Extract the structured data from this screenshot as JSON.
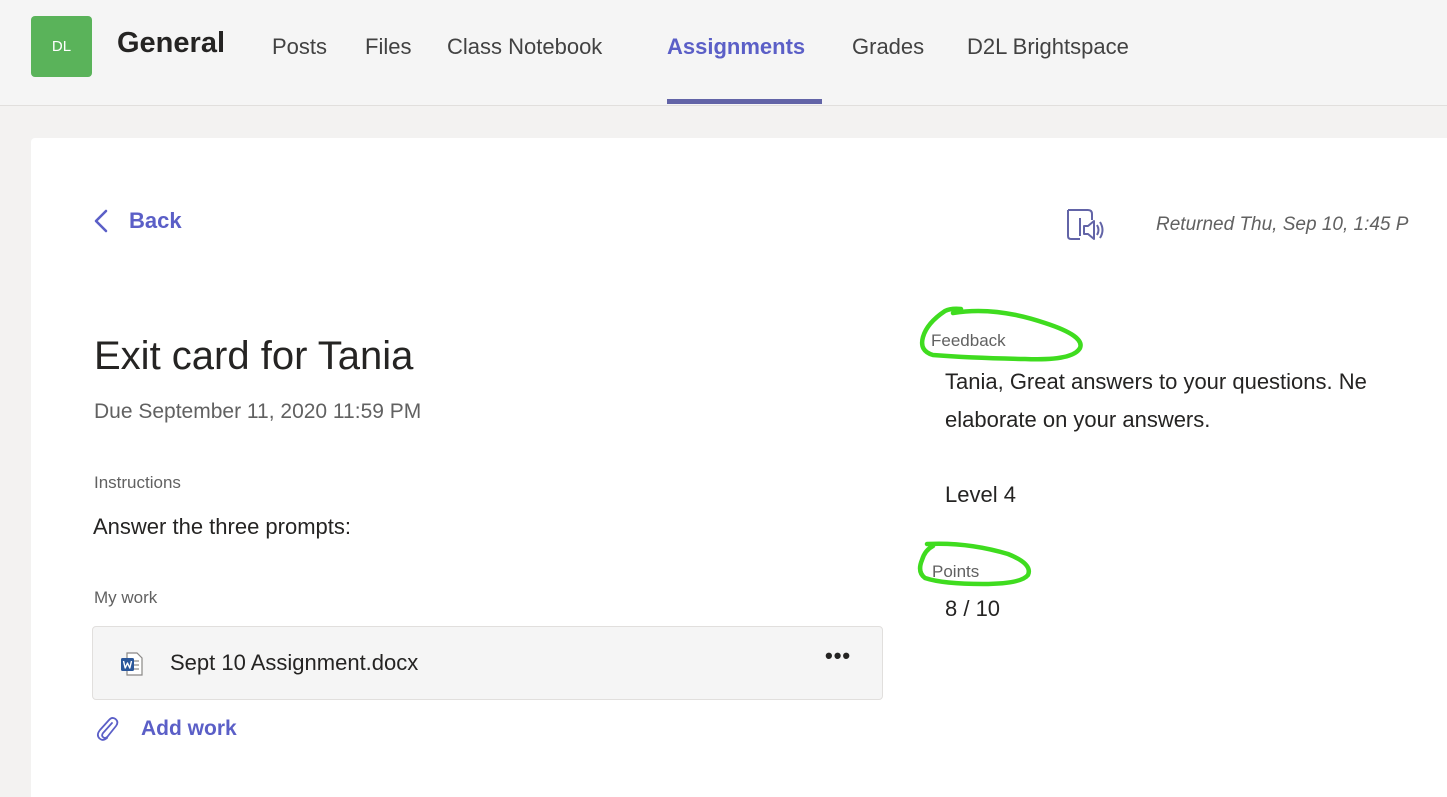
{
  "header": {
    "avatar_initials": "DL",
    "channel": "General",
    "tabs": [
      {
        "label": "Posts"
      },
      {
        "label": "Files"
      },
      {
        "label": "Class Notebook"
      },
      {
        "label": "Assignments",
        "active": true
      },
      {
        "label": "Grades"
      },
      {
        "label": "D2L Brightspace"
      }
    ]
  },
  "nav": {
    "back_label": "Back",
    "returned_text": "Returned Thu, Sep 10, 1:45 P"
  },
  "assignment": {
    "title": "Exit card for Tania",
    "due": "Due September 11, 2020 11:59 PM",
    "instructions_label": "Instructions",
    "instructions": "Answer the three prompts:",
    "my_work_label": "My work",
    "file_name": "Sept 10 Assignment.docx",
    "more_label": "•••",
    "add_work_label": "Add work"
  },
  "feedback": {
    "label": "Feedback",
    "line1": "Tania, Great answers to your questions. Ne",
    "line2": "elaborate on your answers.",
    "level": "Level 4"
  },
  "points": {
    "label": "Points",
    "value": "8 / 10"
  },
  "colors": {
    "accent": "#5b5fc7",
    "avatar": "#5ab35a",
    "highlight": "#3fdc1f"
  }
}
